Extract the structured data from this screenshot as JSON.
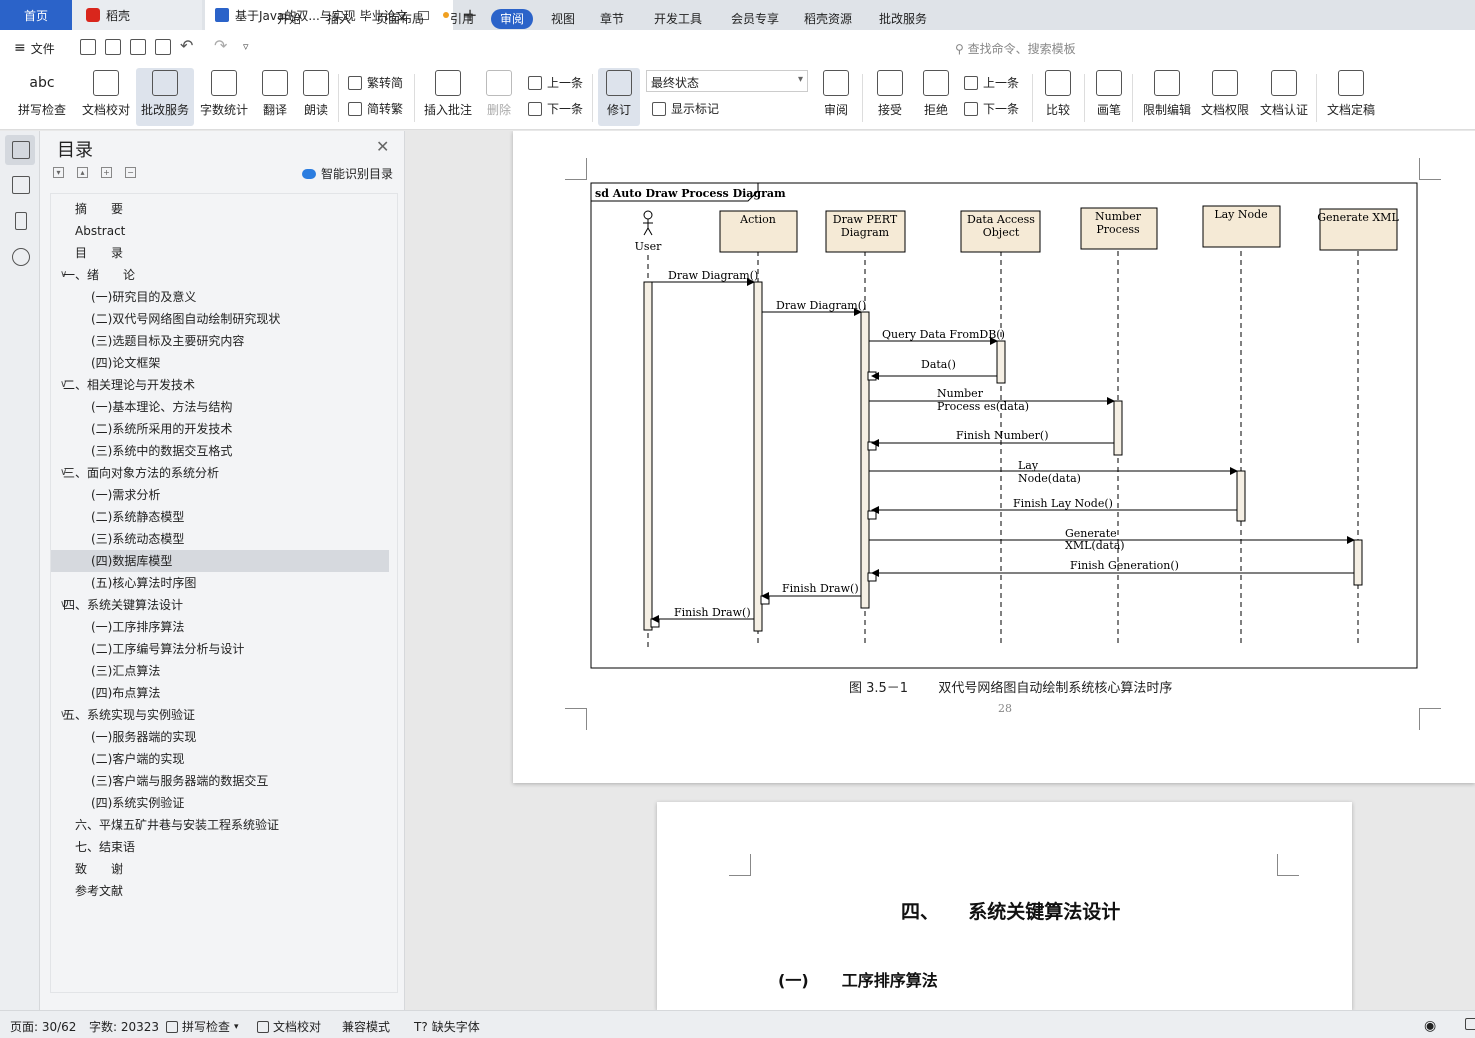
{
  "tabs": {
    "home": "首页",
    "daoke": "稻壳",
    "doc_title": "基于Java的双...与实现 毕业论文",
    "plus": "+"
  },
  "menu": {
    "file": "文件",
    "items": [
      "开始",
      "插入",
      "页面布局",
      "引用",
      "审阅",
      "视图",
      "章节",
      "开发工具",
      "会员专享",
      "稻壳资源",
      "批改服务"
    ],
    "active": "审阅",
    "search": "查找命令、搜索模板"
  },
  "ribbon": {
    "spell": "拼写检查",
    "proof": "文档校对",
    "review_service": "批改服务",
    "word_count": "字数统计",
    "translate": "翻译",
    "read_aloud": "朗读",
    "to_trad": "繁转简",
    "to_simp": "简转繁",
    "insert_comment": "插入批注",
    "delete": "删除",
    "prev": "上一条",
    "next": "下一条",
    "track": "修订",
    "status_select": "最终状态",
    "show_marks": "显示标记",
    "review": "审阅",
    "accept": "接受",
    "reject": "拒绝",
    "prev2": "上一条",
    "next2": "下一条",
    "compare": "比较",
    "pen": "画笔",
    "restrict": "限制编辑",
    "permission": "文档权限",
    "certify": "文档认证",
    "finalize": "文档定稿"
  },
  "toc": {
    "title": "目录",
    "smart": "智能识别目录",
    "items": [
      {
        "text": "摘　　要",
        "level": 0
      },
      {
        "text": "Abstract",
        "level": 0
      },
      {
        "text": "目　　录",
        "level": 0
      },
      {
        "text": "一、绪　　论",
        "level": 1
      },
      {
        "text": "(一)研究目的及意义",
        "level": 2
      },
      {
        "text": "(二)双代号网络图自动绘制研究现状",
        "level": 2
      },
      {
        "text": "(三)选题目标及主要研究内容",
        "level": 2
      },
      {
        "text": "(四)论文框架",
        "level": 2
      },
      {
        "text": "二、相关理论与开发技术",
        "level": 1
      },
      {
        "text": "(一)基本理论、方法与结构",
        "level": 2
      },
      {
        "text": "(二)系统所采用的开发技术",
        "level": 2
      },
      {
        "text": "(三)系统中的数据交互格式",
        "level": 2
      },
      {
        "text": "三、面向对象方法的系统分析",
        "level": 1
      },
      {
        "text": "(一)需求分析",
        "level": 2
      },
      {
        "text": "(二)系统静态模型",
        "level": 2
      },
      {
        "text": "(三)系统动态模型",
        "level": 2
      },
      {
        "text": "(四)数据库模型",
        "level": 2,
        "selected": true
      },
      {
        "text": "(五)核心算法时序图",
        "level": 2
      },
      {
        "text": "四、系统关键算法设计",
        "level": 1
      },
      {
        "text": "(一)工序排序算法",
        "level": 2
      },
      {
        "text": "(二)工序编号算法分析与设计",
        "level": 2
      },
      {
        "text": "(三)汇点算法",
        "level": 2
      },
      {
        "text": "(四)布点算法",
        "level": 2
      },
      {
        "text": "五、系统实现与实例验证",
        "level": 1
      },
      {
        "text": "(一)服务器端的实现",
        "level": 2
      },
      {
        "text": "(二)客户端的实现",
        "level": 2
      },
      {
        "text": "(三)客户端与服务器端的数据交互",
        "level": 2
      },
      {
        "text": "(四)系统实例验证",
        "level": 2
      },
      {
        "text": "六、平煤五矿井巷与安装工程系统验证",
        "level": 0
      },
      {
        "text": "七、结束语",
        "level": 0
      },
      {
        "text": "致　　谢",
        "level": 0
      },
      {
        "text": "参考文献",
        "level": 0
      }
    ]
  },
  "diagram": {
    "frame_label": "sd Auto Draw Process Diagram",
    "actor": "User",
    "lifelines": [
      {
        "name": "Action",
        "line2": ""
      },
      {
        "name": "Draw PERT",
        "line2": "Diagram"
      },
      {
        "name": "Data Access",
        "line2": "Object"
      },
      {
        "name": "Number",
        "line2": "Process"
      },
      {
        "name": "Lay Node",
        "line2": ""
      },
      {
        "name": "Generate XML",
        "line2": ""
      }
    ],
    "messages": [
      {
        "text": "Draw Diagram()",
        "text2": ""
      },
      {
        "text": "Draw Diagram()",
        "text2": ""
      },
      {
        "text": "Query Data FromDB()",
        "text2": ""
      },
      {
        "text": "Data()",
        "text2": ""
      },
      {
        "text": "Number",
        "text2": "Process es(data)"
      },
      {
        "text": "Finish Number()",
        "text2": ""
      },
      {
        "text": "Lay",
        "text2": "Node(data)"
      },
      {
        "text": "Finish Lay Node()",
        "text2": ""
      },
      {
        "text": "Generate",
        "text2": "XML(data)"
      },
      {
        "text": "Finish Generation()",
        "text2": ""
      },
      {
        "text": "Finish Draw()",
        "text2": ""
      },
      {
        "text": "Finish Draw()",
        "text2": ""
      }
    ]
  },
  "page1": {
    "caption_prefix": "图  3.5－1",
    "caption": "双代号网络图自动绘制系统核心算法时序",
    "page_number": "28"
  },
  "page2": {
    "heading1_num": "四、",
    "heading1": "系统关键算法设计",
    "heading2_num": "(一)",
    "heading2": "工序排序算法"
  },
  "status": {
    "page": "页面: 30/62",
    "words": "字数: 20323",
    "spell": "拼写检查",
    "proof": "文档校对",
    "compat": "兼容模式",
    "missing_font": "缺失字体"
  },
  "colors": {
    "accent": "#2b63c9",
    "lifeline_box": "#f5ead6"
  }
}
